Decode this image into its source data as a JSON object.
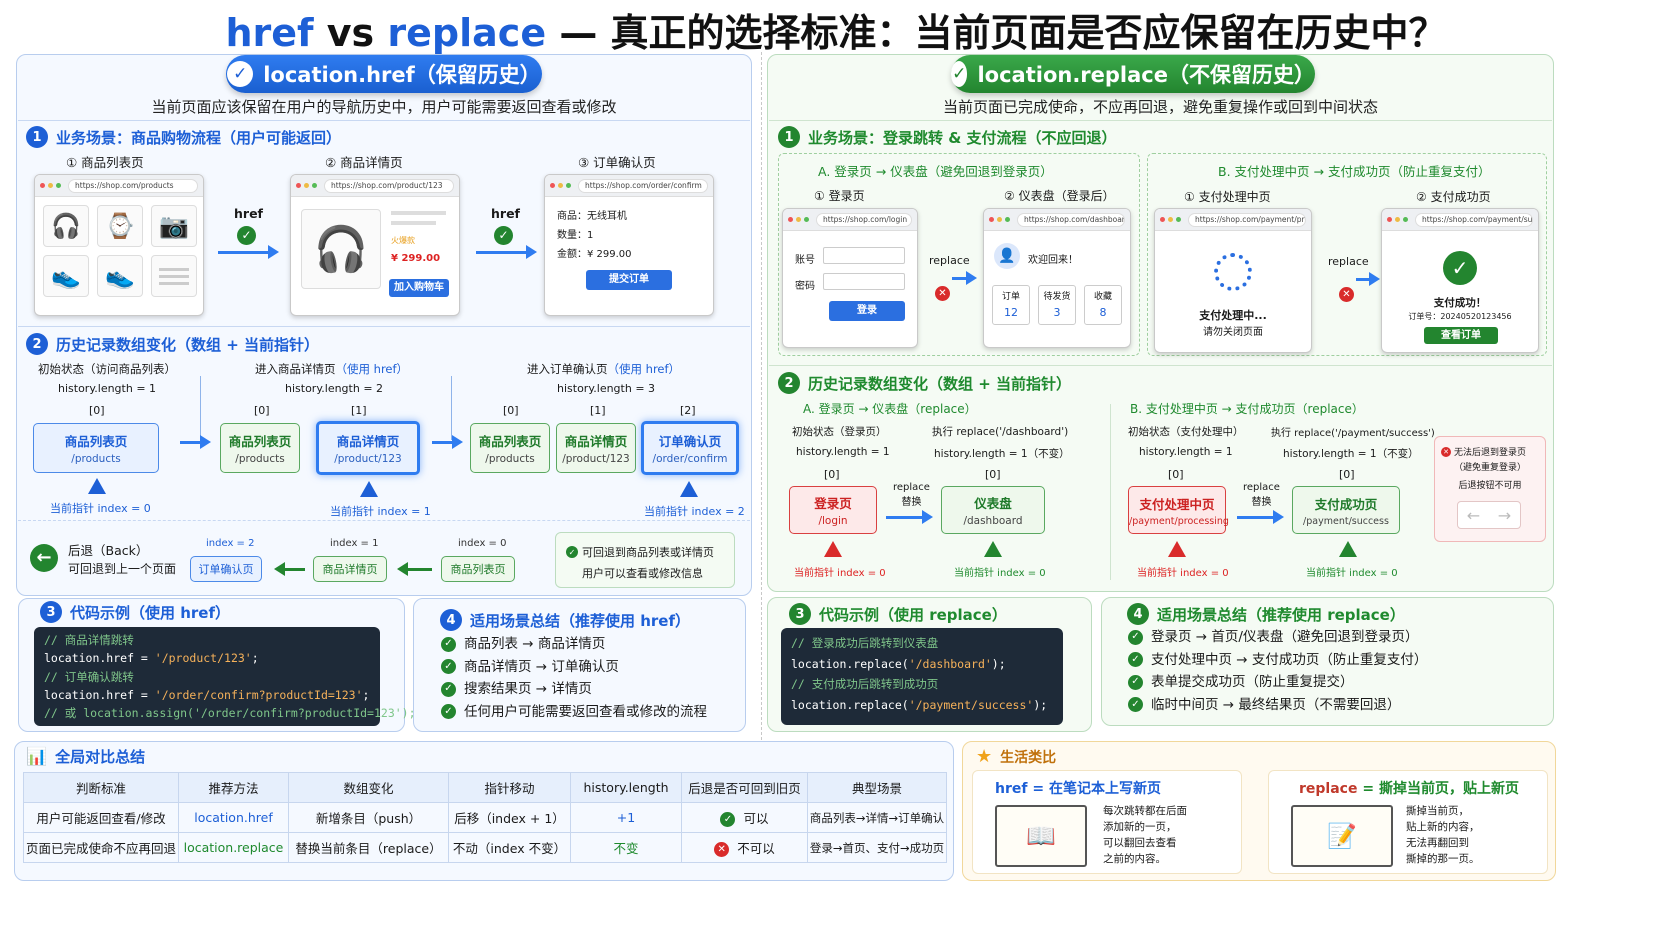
{
  "title": {
    "part1": "href",
    "vs": " vs ",
    "part2": "replace",
    "rest": " — 真正的选择标准：当前页面是否应保留在历史中？"
  },
  "left": {
    "pill": "location.href（保留历史）",
    "subtitle": "当前页面应该保留在用户的导航历史中，用户可能需要返回查看或修改",
    "s1": "业务场景：商品购物流程（用户可能返回）",
    "pages": [
      {
        "label": "① 商品列表页",
        "url": "https://shop.com/products"
      },
      {
        "label": "② 商品详情页",
        "url": "https://shop.com/product/123"
      },
      {
        "label": "③ 订单确认页",
        "url": "https://shop.com/order/confirm"
      }
    ],
    "href_label": "href",
    "detail": {
      "badge": "火爆款",
      "price": "¥ 299.00",
      "btn": "加入购物车"
    },
    "order": {
      "l1": "商品：无线耳机",
      "l2": "数量：1",
      "l3": "金额：¥ 299.00",
      "btn": "提交订单"
    },
    "s2": "历史记录数组变化（数组 + 当前指针）",
    "st1": {
      "title": "初始状态（访问商品列表）",
      "len": "history.length = 1",
      "idx": "[0]",
      "ptr": "当前指针 index = 0"
    },
    "st2": {
      "title": "进入商品详情页",
      "hint": "（使用 href）",
      "len": "history.length = 2",
      "idx0": "[0]",
      "idx1": "[1]",
      "ptr": "当前指针 index = 1"
    },
    "st3": {
      "title": "进入订单确认页",
      "hint": "（使用 href）",
      "len": "history.length = 3",
      "idx0": "[0]",
      "idx1": "[1]",
      "idx2": "[2]",
      "ptr": "当前指针 index = 2"
    },
    "n_list": "商品列表页",
    "p_list": "/products",
    "n_detail": "商品详情页",
    "p_detail": "/product/123",
    "n_order": "订单确认页",
    "p_order": "/order/confirm",
    "back": {
      "title": "后退（Back）",
      "desc": "可回退到上一个页面",
      "i2": "index = 2",
      "i1": "index = 1",
      "i0": "index = 0",
      "b2": "订单确认页",
      "b1": "商品详情页",
      "b0": "商品列表页",
      "note1": "可回退到商品列表或详情页",
      "note2": "用户可以查看或修改信息"
    },
    "s3": "代码示例（使用 href）",
    "code": [
      "// 商品详情跳转",
      "location.href = ",
      "'/product/123'",
      ";",
      "// 订单确认跳转",
      "location.href = ",
      "'/order/confirm?productId=123'",
      ";",
      "// 或 location.assign('/order/confirm?productId=123');"
    ],
    "s4": "适用场景总结（推荐使用 href）",
    "list": [
      "商品列表 → 商品详情页",
      "商品详情页 → 订单确认页",
      "搜索结果页 → 详情页",
      "任何用户可能需要返回查看或修改的流程"
    ]
  },
  "right": {
    "pill": "location.replace（不保留历史）",
    "subtitle": "当前页面已完成使命，不应再回退，避免重复操作或回到中间状态",
    "s1": "业务场景：登录跳转 & 支付流程（不应回退）",
    "a_title": "A. 登录页 → 仪表盘（避免回退到登录页）",
    "b_title": "B. 支付处理中页 → 支付成功页（防止重复支付）",
    "a1": "① 登录页",
    "a2": "② 仪表盘（登录后）",
    "b1": "① 支付处理中页",
    "b2": "② 支付成功页",
    "urls": [
      "https://shop.com/login",
      "https://shop.com/dashboard",
      "https://shop.com/payment/processing",
      "https://shop.com/payment/success"
    ],
    "login": {
      "acc": "账号",
      "pwd": "密码",
      "btn": "登录"
    },
    "dash": {
      "welcome": "欢迎回来！",
      "c1": "订单",
      "v1": "12",
      "c2": "待发货",
      "v2": "3",
      "c3": "收藏",
      "v3": "8"
    },
    "proc": {
      "l1": "支付处理中...",
      "l2": "请勿关闭页面"
    },
    "succ": {
      "l1": "支付成功！",
      "l2": "订单号：20240520123456",
      "btn": "查看订单"
    },
    "replace_label": "replace",
    "s2": "历史记录数组变化（数组 + 当前指针）",
    "ha": {
      "title": "A. 登录页 → 仪表盘（replace）",
      "init": "初始状态（登录页）",
      "exec": "执行 replace('/dashboard')",
      "len1": "history.length = 1",
      "len2": "history.length = 1（不变）",
      "idx": "[0]",
      "n1": "登录页",
      "p1": "/login",
      "n2": "仪表盘",
      "p2": "/dashboard",
      "rl": "replace",
      "rt": "替换",
      "ptr": "当前指针 index = 0"
    },
    "hb": {
      "title": "B. 支付处理中页 → 支付成功页（replace）",
      "init": "初始状态（支付处理中）",
      "exec": "执行 replace('/payment/success')",
      "len1": "history.length = 1",
      "len2": "history.length = 1（不变）",
      "idx": "[0]",
      "n1": "支付处理中页",
      "p1": "/payment/processing",
      "n2": "支付成功页",
      "p2": "/payment/success",
      "rl": "replace",
      "rt": "替换",
      "ptr": "当前指针 index = 0"
    },
    "noback": {
      "l1": "无法后退到登录页",
      "l2": "（避免重复登录）",
      "l3": "后退按钮不可用"
    },
    "s3": "代码示例（使用 replace）",
    "code": [
      "// 登录成功后跳转到仪表盘",
      "location.replace(",
      "'/dashboard'",
      ");",
      "// 支付成功后跳转到成功页",
      "location.replace(",
      "'/payment/success'",
      ");"
    ],
    "s4": "适用场景总结（推荐使用 replace）",
    "list": [
      "登录页 → 首页/仪表盘（避免回退到登录页）",
      "支付处理中页 → 支付成功页（防止重复支付）",
      "表单提交成功页（防止重复提交）",
      "临时中间页 → 最终结果页（不需要回退）"
    ]
  },
  "summary": {
    "title": "全局对比总结",
    "headers": [
      "判断标准",
      "推荐方法",
      "数组变化",
      "指针移动",
      "history.length",
      "后退是否可回到旧页",
      "典型场景"
    ],
    "rows": [
      [
        "用户可能返回查看/修改",
        "location.href",
        "新增条目（push）",
        "后移（index + 1）",
        "+1",
        "可以",
        "商品列表→详情→订单确认"
      ],
      [
        "页面已完成使命不应再回退",
        "location.replace",
        "替换当前条目（replace）",
        "不动（index 不变）",
        "不变",
        "不可以",
        "登录→首页、支付→成功页"
      ]
    ]
  },
  "life": {
    "title": "生活类比",
    "href_h": "href",
    "href_t": " = 在笔记本上写新页",
    "href_d": [
      "每次跳转都在后面",
      "添加新的一页，",
      "可以翻回去查看",
      "之前的内容。"
    ],
    "rep_h": "replace",
    "rep_t": " = 撕掉当前页，贴上新页",
    "rep_d": [
      "撕掉当前页，",
      "贴上新的内容，",
      "无法再翻回到",
      "撕掉的那一页。"
    ]
  }
}
